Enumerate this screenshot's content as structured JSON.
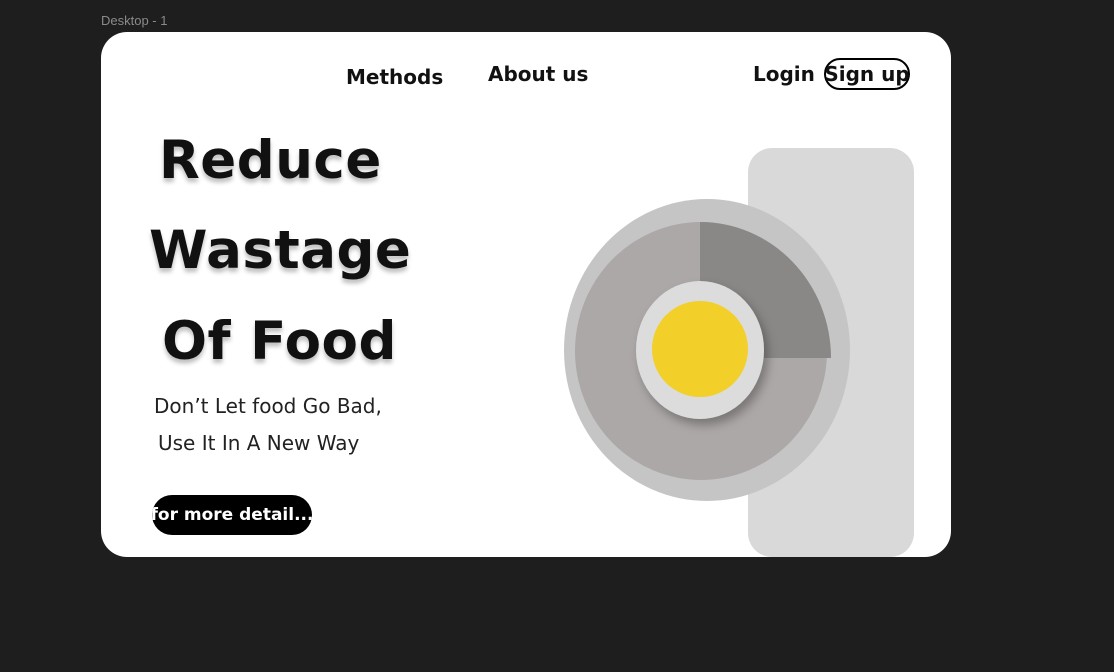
{
  "frame": {
    "label": "Desktop - 1"
  },
  "nav": {
    "methods": "Methods",
    "about": "About us",
    "login": "Login",
    "signup": "Sign up"
  },
  "hero": {
    "line1": "Reduce",
    "line2": "Wastage",
    "line3": "Of Food",
    "tagline1": "Don’t Let food Go Bad,",
    "tagline2": "Use It In A New Way",
    "cta": "for more detail..."
  },
  "illustration": {
    "name": "plate-with-food-illustration",
    "colors": {
      "outer_ring": "#c6c5c6",
      "plate": "#ada8a8",
      "slice": "#8a8886",
      "inner_ring": "#dddcdc",
      "yolk": "#f2cf29",
      "panel": "#d9d9d9"
    }
  }
}
